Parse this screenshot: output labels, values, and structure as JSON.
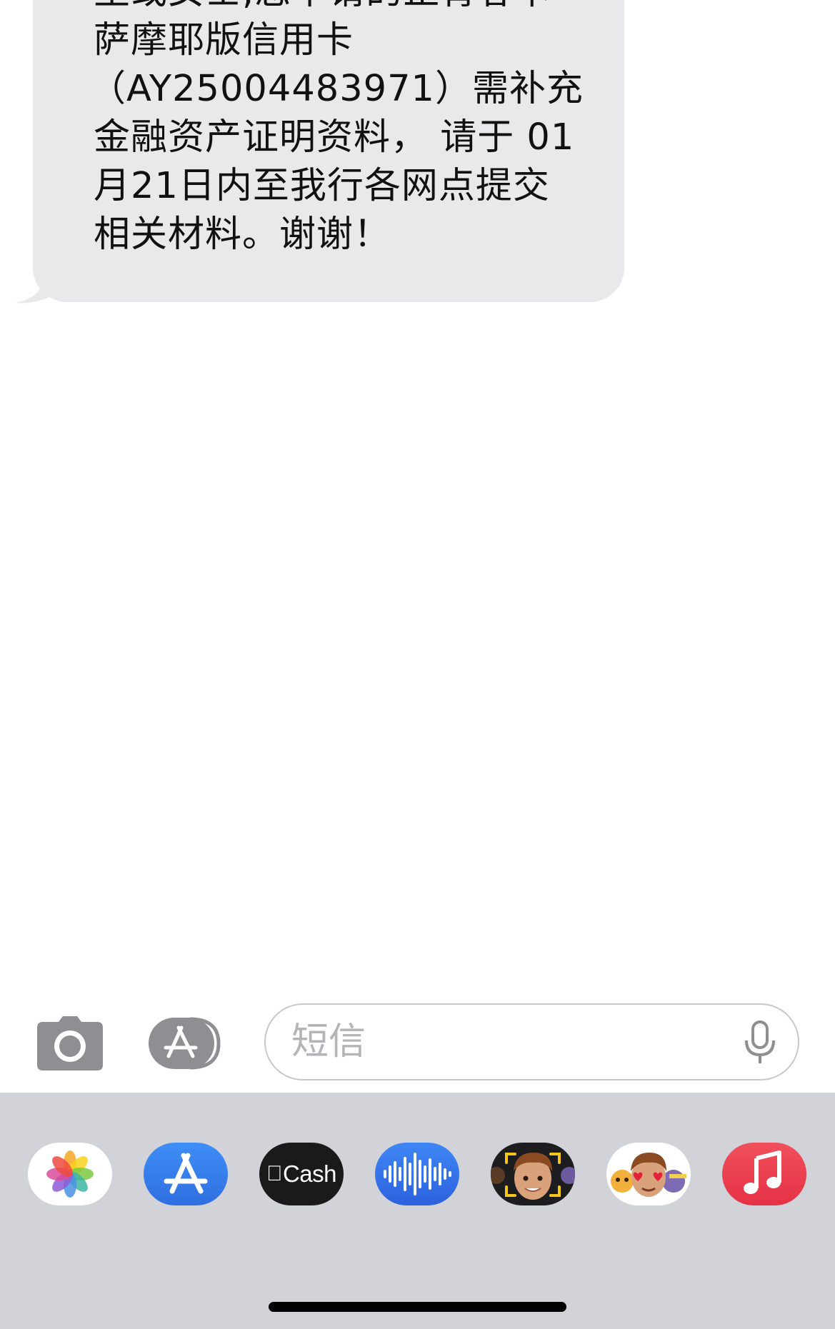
{
  "message": {
    "lines": [
      "生或女士,您申请的正青春卡",
      "萨摩耶版信用卡",
      "（AY25004483971）需补充",
      "金融资产证明资料， 请于 01",
      "月21日内至我行各网点提交",
      "相关材料。谢谢！"
    ],
    "bubble_color": "#e9e9eb"
  },
  "input": {
    "placeholder": "短信",
    "value": ""
  },
  "input_icons": {
    "camera": "camera-icon",
    "apps": "app-store-icon",
    "mic": "microphone-icon"
  },
  "app_drawer": {
    "apps": [
      {
        "name": "Photos",
        "icon": "photos-icon"
      },
      {
        "name": "App Store",
        "icon": "app-store-icon"
      },
      {
        "name": "Apple Cash",
        "icon": "apple-cash-icon",
        "label": "Cash"
      },
      {
        "name": "Audio Message",
        "icon": "waveform-icon"
      },
      {
        "name": "Memoji",
        "icon": "memoji-icon"
      },
      {
        "name": "Memoji Stickers",
        "icon": "memoji-stickers-icon"
      },
      {
        "name": "Music",
        "icon": "music-note-icon"
      }
    ],
    "background": "#d1d3d9"
  }
}
